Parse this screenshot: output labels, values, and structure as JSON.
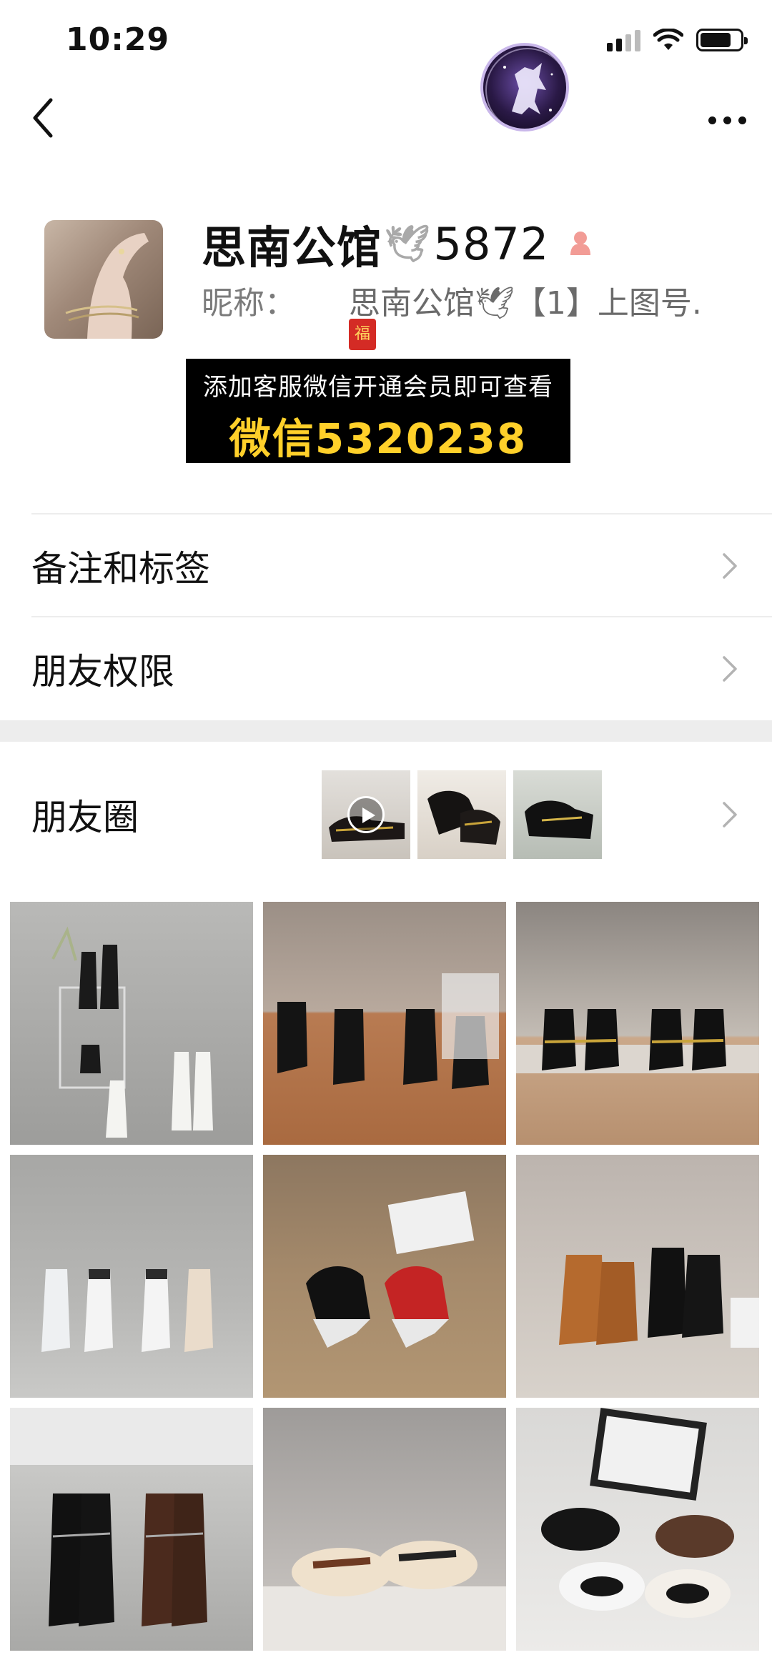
{
  "status_bar": {
    "time": "10:29"
  },
  "nav": {
    "back_icon": "chevron-left-icon",
    "more_icon": "ellipsis-icon"
  },
  "profile": {
    "display_name": "思南公馆",
    "name_emoji": "🕊",
    "name_suffix": "5872",
    "nickname_label": "昵称：",
    "nickname_value": "思南公馆🕊【1】上图号.",
    "red_tag": "福"
  },
  "promo": {
    "line1": "添加客服微信开通会员即可查看",
    "line2": "微信5320238"
  },
  "menu": {
    "remarks_label": "备注和标签",
    "permissions_label": "朋友权限",
    "moments_label": "朋友圈"
  },
  "colors": {
    "promo_bg": "#000000",
    "promo_highlight": "#ffd02a",
    "divider": "#ededed",
    "secondary_text": "#7b7b7b"
  }
}
